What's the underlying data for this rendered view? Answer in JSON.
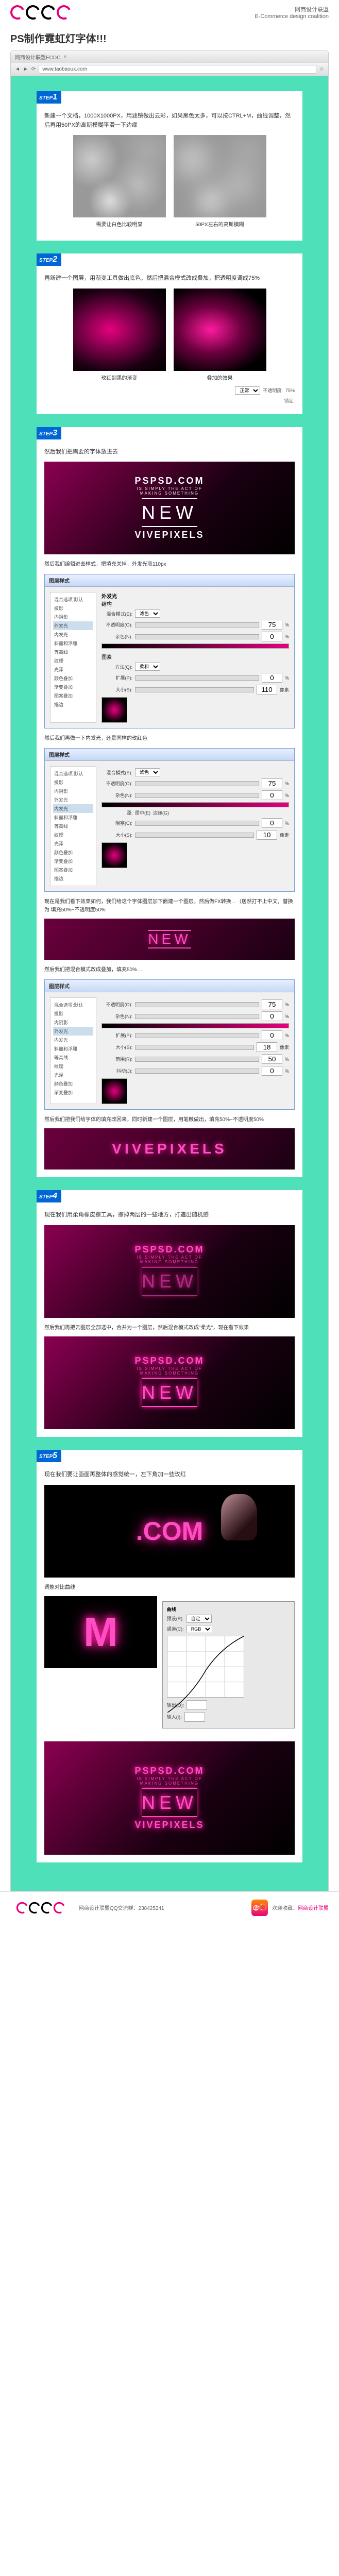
{
  "header": {
    "brand_cn": "网商设计联盟",
    "brand_en": "E-Commerce design coalition"
  },
  "title": "PS制作霓虹灯字体!!!",
  "browser": {
    "tab": "网商设计联盟ECDC",
    "url": "www.taobaoux.com"
  },
  "steps": {
    "s1": {
      "badge": "STEP",
      "num": "1",
      "text": "新建一个文档，1000X1000PX，用滤镜做出云彩，如果黑色太多，可以按CTRL+M，曲线调整，然后再用50PX的高斯模糊平滑一下边缘",
      "cap1": "需要让白色比较明显",
      "cap2": "50PX左右的高斯模糊"
    },
    "s2": {
      "badge": "STEP",
      "num": "2",
      "text": "再新建一个图层，用渐变工具做出底色，然后把混合模式改成叠加，把透明度调成75%",
      "cap1": "玫红到黑的渐变",
      "cap2": "叠加的效果",
      "blend_label": "正常",
      "opacity_label": "不透明度:",
      "opacity_val": "75%",
      "lock_label": "锁定:"
    },
    "s3": {
      "badge": "STEP",
      "num": "3",
      "text": "然后我们把需要的字体放进去",
      "preview": {
        "line1": "PSPSD.COM",
        "line2": "IS SIMPLY THE ACT OF",
        "line3": "MAKING SOMETHING",
        "line4": "NEW",
        "line5": "VIVEPIXELS"
      },
      "sub1": "然后我们编辑进去样式，把填充关掉，外发光取110px",
      "dialog1_title": "图层样式",
      "styles_list": [
        "混合选项:默认",
        "投影",
        "内阴影",
        "外发光",
        "内发光",
        "斜面和浮雕",
        "等高线",
        "纹理",
        "光泽",
        "颜色叠加",
        "渐变叠加",
        "图案叠加",
        "描边"
      ],
      "glow_section": "外发光",
      "struct_label": "结构",
      "blend_mode_label": "混合模式(E):",
      "blend_mode_val": "滤色",
      "opacity_label": "不透明度(O):",
      "opacity_val": "75",
      "noise_label": "杂色(N):",
      "noise_val": "0",
      "elements_label": "图素",
      "method_label": "方法(Q):",
      "method_val": "柔和",
      "spread_label": "扩展(P):",
      "spread_val": "0",
      "size_label": "大小(S):",
      "size_val": "110",
      "px": "像素",
      "pct": "%",
      "sub2": "然后我们再做一下内发光，还是同样的玫红色",
      "inner_size_val": "10",
      "inner_source_label": "源:",
      "inner_center": "居中(E)",
      "inner_edge": "边缘(G)",
      "inner_choke_label": "阻塞(C):",
      "sub3": "现在是我们看下效果如何，我们给这个字体图层加下面建一个图层，然后做FX转换…（居然打不上中文，替换为 填充50%~不透明度50%",
      "wide_text": "VIVEPIXELS",
      "sub4": "然后我们把混合模式改成叠加，填充50%…",
      "dialog3_title": "图层样式",
      "range_label": "范围(R):",
      "range_val": "50",
      "jitter_label": "抖动(J):",
      "jitter_val": "0",
      "sub5": "然后我们把我们给字体的填充改回来，同时新建一个图层，用笔触做出，填充50%~不透明度50%",
      "wide_text2": "VIVEPIXELS"
    },
    "s4": {
      "badge": "STEP",
      "num": "4",
      "text": "现在我们用柔角橡皮擦工具，擦掉两层的一些地方，打造出随机感",
      "sub1": "然后我们再把云图层全部选中，合并为一个图层，然后混合模式改成\"柔光\"，现在看下效果"
    },
    "s5": {
      "badge": "STEP",
      "num": "5",
      "text": "现在我们要让画面再整体的感觉统一，左下角加一些玫红",
      "close_text": ".COM",
      "sub1": "调整对比曲线",
      "close_text2": "M",
      "curves_title": "曲线",
      "preset_label": "预设(R):",
      "preset_val": "自定",
      "channel_label": "通道(C):",
      "channel_val": "RGB",
      "output_label": "输出(O):",
      "input_label": "输入(I):"
    }
  },
  "footer": {
    "qq_label": "网商设计联盟QQ交流群：",
    "qq_num": "238425241",
    "weibo_label": "欢迎收藏：",
    "weibo_name": "网商设计联盟"
  }
}
